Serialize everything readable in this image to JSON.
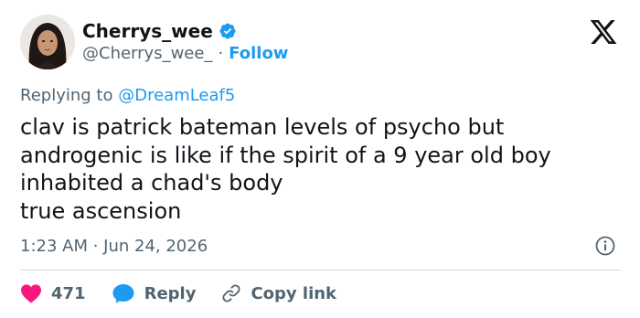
{
  "author": {
    "display_name": "Cherrys_wee",
    "handle": "@Cherrys_wee_",
    "separator": "·",
    "follow_label": "Follow"
  },
  "reply": {
    "prefix": "Replying to",
    "mention": "@DreamLeaf5"
  },
  "tweet": {
    "text": "clav is patrick bateman levels of psycho but\nandrogenic is like if the spirit of a 9 year old boy\ninhabited a chad's body\ntrue ascension"
  },
  "meta": {
    "timestamp": "1:23 AM · Jun 24, 2026"
  },
  "actions": {
    "like_count": "471",
    "reply_label": "Reply",
    "copy_link_label": "Copy link"
  },
  "colors": {
    "accent": "#1d9bf0",
    "like": "#f91880",
    "muted": "#536471",
    "text": "#0f1419"
  },
  "icons": [
    "verified-badge-icon",
    "x-logo-icon",
    "info-icon",
    "heart-icon",
    "reply-bubble-icon",
    "link-icon"
  ]
}
